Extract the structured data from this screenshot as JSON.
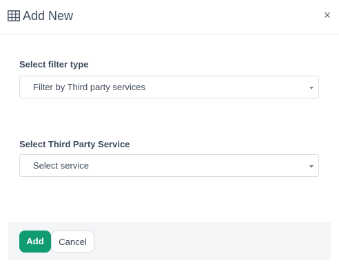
{
  "dialog": {
    "title": "Add New",
    "title_icon": "table-grid-icon",
    "close_label": "×"
  },
  "filter_type": {
    "label": "Select filter type",
    "selected": "Filter by Third party services"
  },
  "third_party_service": {
    "label": "Select Third Party Service",
    "selected": "Select service"
  },
  "footer": {
    "add_label": "Add",
    "cancel_label": "Cancel"
  },
  "colors": {
    "primary": "#119b71",
    "footer_bg": "#f4f5f6",
    "text": "#3b4654"
  }
}
